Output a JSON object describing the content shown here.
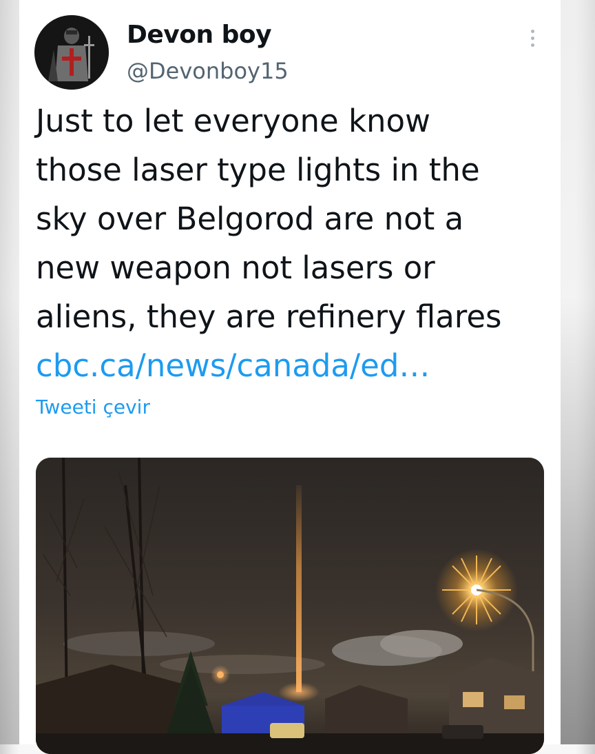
{
  "tweet": {
    "author": {
      "display_name": "Devon boy",
      "handle": "@Devonboy15",
      "avatar_icon": "templar-knight-avatar"
    },
    "text_lines": [
      "Just to let everyone know",
      "those laser type lights in the",
      "sky over Belgorod are not a",
      "new weapon not lasers or",
      "aliens, they are refinery flares"
    ],
    "link": "cbc.ca/news/canada/ed…",
    "translate_label": "Tweeti çevir",
    "menu_icon": "more-vertical-icon",
    "media": {
      "kind": "photo",
      "description_icon": "night-sky-light-pillar-photo"
    },
    "colors": {
      "link": "#1d9bf0",
      "text": "#0f1419",
      "secondary": "#536471"
    }
  }
}
